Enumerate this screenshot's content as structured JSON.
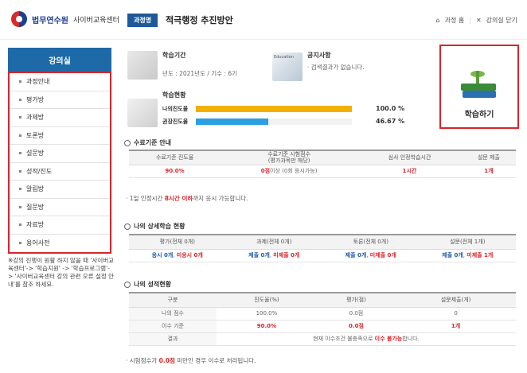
{
  "header": {
    "logo_name": "법무연수원",
    "logo_sub": "사이버교육센터",
    "tag": "과정명",
    "course_title": "적극행정 추진방안",
    "home_label": "과정 홈",
    "close_label": "강의실 닫기"
  },
  "sidebar": {
    "title": "강의실",
    "items": [
      {
        "label": "과정안내"
      },
      {
        "label": "평가방"
      },
      {
        "label": "과제방"
      },
      {
        "label": "토론방"
      },
      {
        "label": "설문방"
      },
      {
        "label": "성적/진도"
      },
      {
        "label": "알림방"
      },
      {
        "label": "질문방"
      },
      {
        "label": "자료방"
      },
      {
        "label": "용어사전"
      }
    ],
    "note": "※강의 진행이 원활 하지 않을 때 '사이버교육센터'-> '학습지원' -> '학습프로그램'-> '사이버교육센터 강의 관련 오류 설정 안내'를 참조 하세요."
  },
  "study_period": {
    "label": "학습기간",
    "value": "년도 : 2021년도 / 기수 : 6기"
  },
  "notice": {
    "label": "공지사항",
    "value": "· 검색결과가 없습니다.",
    "thumb_text": "Education"
  },
  "status": {
    "label": "학습현황",
    "rows": [
      {
        "name": "나의진도율",
        "percent": 100.0,
        "value": "100.0 %",
        "color": "#f4b000"
      },
      {
        "name": "권장진도율",
        "percent": 46.67,
        "value": "46.67 %",
        "color": "#2aa0e0"
      }
    ]
  },
  "study_button": {
    "label": "학습하기"
  },
  "completion": {
    "title": "수료기준 안내",
    "headers": [
      "수료기준 진도율",
      "수료기준 시험점수\n(평가과목만 해당)",
      "심사 인정학습시간",
      "설문 제출"
    ],
    "progress": "90.0%",
    "exam_main": "0점",
    "exam_tail": "이상 (0회 응시가능)",
    "hours": "1시간",
    "survey": "1개",
    "note_prefix": "· 1일 인정시간 ",
    "note_strong": "8시간 이하",
    "note_suffix": "까지 응시 가능합니다."
  },
  "detail": {
    "title": "나의 상세학습 현황",
    "headers": [
      "평가(전체 0개)",
      "과제(전체 0개)",
      "토론(전체 0개)",
      "설문(전체 1개)"
    ],
    "cells": [
      {
        "a": "응시 0개",
        "b": "미응시 0개"
      },
      {
        "a": "제출 0개",
        "b": "미제출 0개"
      },
      {
        "a": "제출 0개",
        "b": "미제출 0개"
      },
      {
        "a": "제출 0개",
        "b": "미제출 1개"
      }
    ]
  },
  "grades": {
    "title": "나의 성적현황",
    "headers": [
      "구분",
      "진도율(%)",
      "평가(점)",
      "설문제출(개)"
    ],
    "rows": [
      {
        "label": "나의 점수",
        "progress": "100.0%",
        "exam": "0.0점",
        "survey": "0"
      },
      {
        "label": "이수 기준",
        "progress": "90.0%",
        "exam": "0.0점",
        "survey": "1개"
      }
    ],
    "result_label": "결과",
    "result_text": "현재 이수조건 불충족으로 ",
    "result_strong": "이수 불가능",
    "result_tail": "합니다.",
    "note_prefix": "· 시험점수가 ",
    "note_strong": "0.0점",
    "note_suffix": " 미만인 경우 이수로 처리됩니다."
  }
}
